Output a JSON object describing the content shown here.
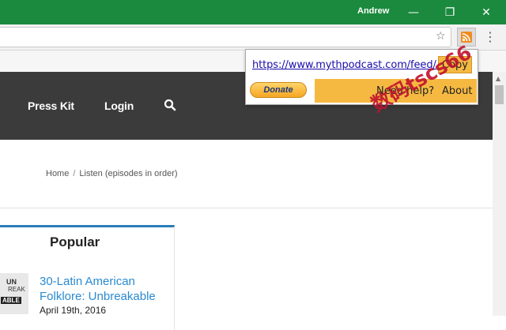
{
  "window": {
    "profile_name": "Andrew",
    "minimize_glyph": "—",
    "restore_glyph": "❐",
    "close_glyph": "✕",
    "titlebar_color": "#1b8a3e"
  },
  "toolbar": {
    "address_value": "",
    "bookmark_star_glyph": "☆",
    "menu_glyph": "⋮"
  },
  "site": {
    "nav": {
      "press_kit": "Press Kit",
      "login": "Login"
    },
    "breadcrumb": {
      "home": "Home",
      "separator": "/",
      "current": "Listen (episodes in order)"
    },
    "popular": {
      "title": "Popular",
      "thumb_line1": "UN",
      "thumb_line2": "REAK",
      "thumb_line3": "ABLE",
      "episode_title": "30-Latin American Folklore: Unbreakable",
      "episode_date": "April 19th, 2016"
    }
  },
  "popup": {
    "feed_url": "https://www.mythpodcast.com/feed/",
    "copy_label": "Copy",
    "donate_label": "Donate",
    "need_help_label": "Need help?",
    "about_label": "About",
    "accent_color": "#f5b942"
  },
  "watermark": "数码tscs66"
}
